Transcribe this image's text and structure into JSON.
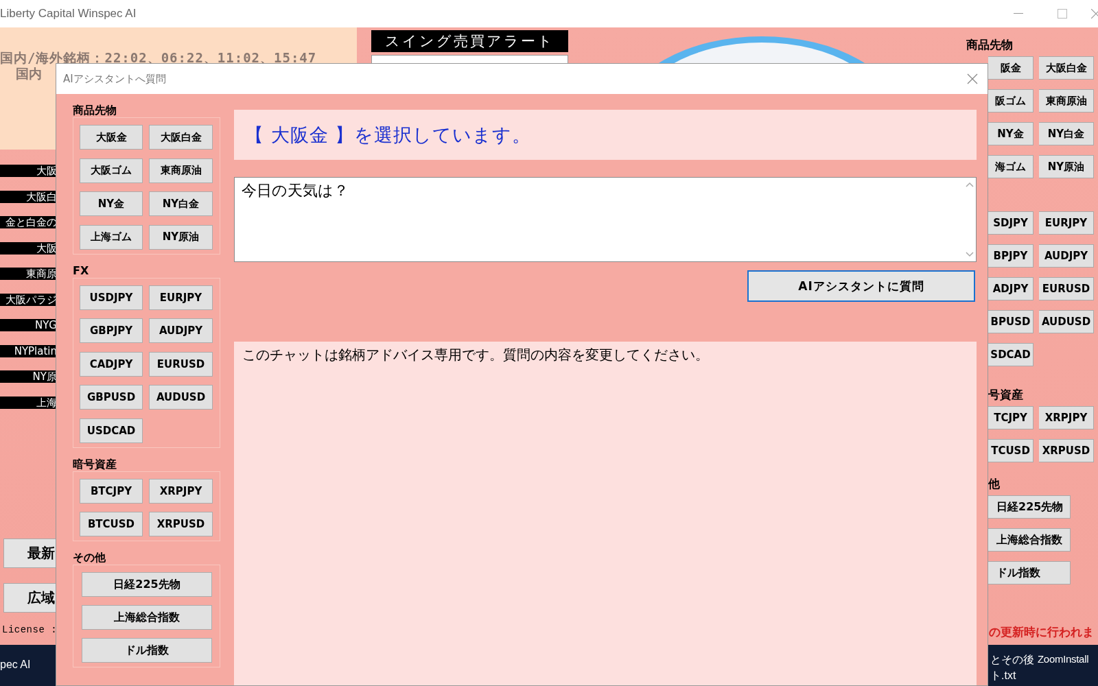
{
  "window": {
    "title": "Liberty Capital Winspec AI"
  },
  "main": {
    "schedule": "国内/海外銘柄：22:02、06:22、11:02、15:47",
    "schedule_2": "国内",
    "alert_title": "スイング売買アラート",
    "symbol_labels": [
      "大阪",
      "大阪白",
      "金と白金の",
      "大阪",
      "東商原",
      "大阪パラジ",
      "NYG",
      "NYPlatin",
      "NY原",
      "上海"
    ],
    "buttons": [
      "最新",
      "広域"
    ],
    "license": "License :",
    "right_panel": {
      "sections": [
        {
          "title": "商品先物",
          "kind": "grid",
          "buttons": [
            "阪金",
            "大阪白金",
            "阪ゴム",
            "東商原油",
            "NY金",
            "NY白金",
            "海ゴム",
            "NY原油"
          ]
        },
        {
          "kind": "grid",
          "buttons": [
            "SDJPY",
            "EURJPY",
            "BPJPY",
            "AUDJPY",
            "ADJPY",
            "EURUSD",
            "BPUSD",
            "AUDUSD",
            "SDCAD"
          ]
        },
        {
          "title": "号資産",
          "kind": "grid",
          "buttons": [
            "TCJPY",
            "XRPJPY",
            "TCUSD",
            "XRPUSD"
          ]
        },
        {
          "title": "他",
          "kind": "wide",
          "buttons": [
            "日経225先物",
            "上海総合指数",
            "ドル指数"
          ]
        }
      ],
      "notice": "の更新時に行われま"
    }
  },
  "dialog": {
    "title": "AIアシスタントへ質問",
    "groups": [
      {
        "title": "商品先物",
        "kind": "grid",
        "buttons": [
          "大阪金",
          "大阪白金",
          "大阪ゴム",
          "東商原油",
          "NY金",
          "NY白金",
          "上海ゴム",
          "NY原油"
        ]
      },
      {
        "title": "FX",
        "kind": "grid",
        "buttons": [
          "USDJPY",
          "EURJPY",
          "GBPJPY",
          "AUDJPY",
          "CADJPY",
          "EURUSD",
          "GBPUSD",
          "AUDUSD",
          "USDCAD"
        ]
      },
      {
        "title": "暗号資産",
        "kind": "grid",
        "buttons": [
          "BTCJPY",
          "XRPJPY",
          "BTCUSD",
          "XRPUSD"
        ]
      },
      {
        "title": "その他",
        "kind": "wide",
        "buttons": [
          "日経225先物",
          "上海総合指数",
          "ドル指数"
        ]
      }
    ],
    "selection": "【 大阪金 】を選択しています。",
    "question": "今日の天気は？",
    "ask_button": "AIアシスタントに質問",
    "answer": "このチャットは銘柄アドバイス専用です。質問の内容を変更してください。"
  },
  "taskbar": {
    "items": [
      "pec AI"
    ],
    "right_texts": [
      "とその後",
      "ZoomInstall",
      "ト.txt"
    ]
  }
}
